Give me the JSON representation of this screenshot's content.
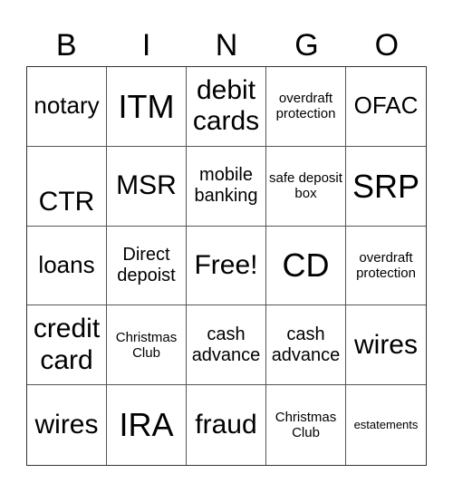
{
  "header": [
    "B",
    "I",
    "N",
    "G",
    "O"
  ],
  "cells": [
    "notary",
    "ITM",
    "debit cards",
    "overdraft protection",
    "OFAC",
    "CTR",
    "MSR",
    "mobile banking",
    "safe deposit box",
    "SRP",
    "loans",
    "Direct depoist",
    "Free!",
    "CD",
    "overdraft protection",
    "credit card",
    "Christmas Club",
    "cash advance",
    "cash advance",
    "wires",
    "wires",
    "IRA",
    "fraud",
    "Christmas Club",
    "estatements"
  ]
}
